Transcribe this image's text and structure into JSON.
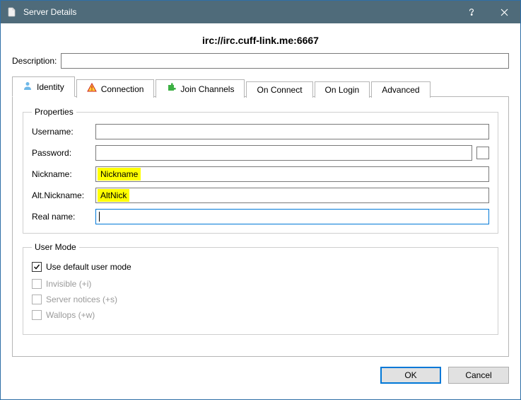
{
  "window": {
    "title": "Server Details"
  },
  "url_heading": "irc://irc.cuff-link.me:6667",
  "description": {
    "label": "Description:",
    "value": ""
  },
  "tabs": {
    "identity": "Identity",
    "connection": "Connection",
    "join_channels": "Join Channels",
    "on_connect": "On Connect",
    "on_login": "On Login",
    "advanced": "Advanced"
  },
  "properties": {
    "legend": "Properties",
    "username_label": "Username:",
    "username_value": "",
    "password_label": "Password:",
    "password_value": "",
    "nickname_label": "Nickname:",
    "nickname_value": "Nickname",
    "altnick_label": "Alt.Nickname:",
    "altnick_value": "AltNick",
    "realname_label": "Real name:",
    "realname_value": ""
  },
  "user_mode": {
    "legend": "User Mode",
    "use_default": "Use default user mode",
    "invisible": "Invisible (+i)",
    "server_notices": "Server notices (+s)",
    "wallops": "Wallops (+w)"
  },
  "buttons": {
    "ok": "OK",
    "cancel": "Cancel"
  }
}
